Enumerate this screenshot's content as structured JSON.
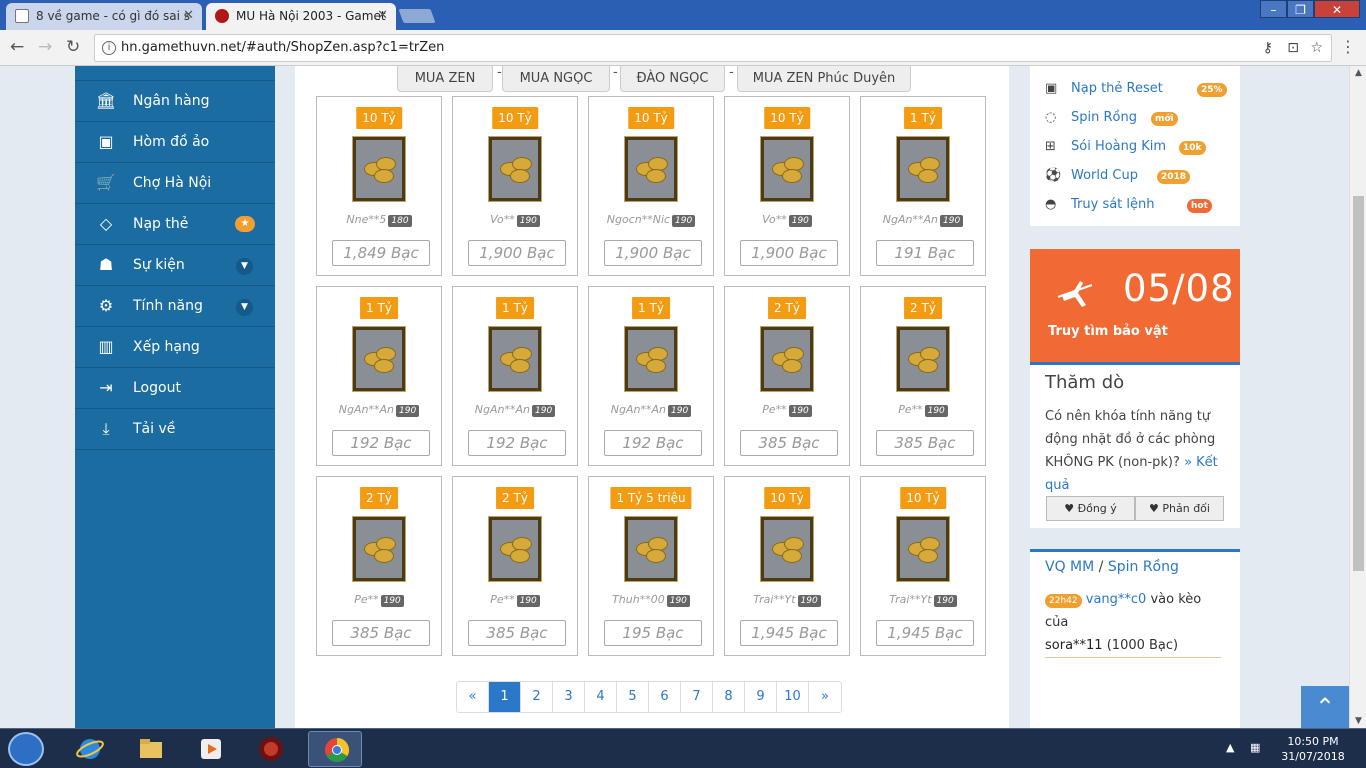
{
  "browser": {
    "tabs": [
      {
        "label": "8 về game - có gì đó sai s"
      },
      {
        "label": "MU Hà Nội 2003 - Gamet"
      }
    ],
    "url": "hn.gamethuvn.net/#auth/ShopZen.asp?c1=trZen"
  },
  "sidebar": {
    "items": [
      {
        "label": "Ngân hàng",
        "icon": "bank-icon"
      },
      {
        "label": "Hòm đồ ảo",
        "icon": "briefcase-icon"
      },
      {
        "label": "Chợ Hà Nội",
        "icon": "cart-icon"
      },
      {
        "label": "Nạp thẻ",
        "icon": "diamond-icon"
      },
      {
        "label": "Sự kiện",
        "icon": "android-icon"
      },
      {
        "label": "Tính năng",
        "icon": "cogs-icon"
      },
      {
        "label": "Xếp hạng",
        "icon": "bar-chart-icon"
      },
      {
        "label": "Logout",
        "icon": "sign-out-icon"
      },
      {
        "label": "Tải về",
        "icon": "download-icon"
      }
    ]
  },
  "shop": {
    "tabs": [
      "MUA ZEN",
      "MUA NGỌC",
      "ĐÀO NGỌC",
      "MUA ZEN Phúc Duyên"
    ],
    "separator": "-",
    "items": [
      {
        "amount": "10 Tỷ",
        "seller": "Nne**5",
        "level": "180",
        "price": "1,849 Bạc"
      },
      {
        "amount": "10 Tỷ",
        "seller": "Vo**",
        "level": "190",
        "price": "1,900 Bạc"
      },
      {
        "amount": "10 Tỷ",
        "seller": "Ngocn**Nic",
        "level": "190",
        "price": "1,900 Bạc"
      },
      {
        "amount": "10 Tỷ",
        "seller": "Vo**",
        "level": "190",
        "price": "1,900 Bạc"
      },
      {
        "amount": "1 Tỷ",
        "seller": "NgAn**An",
        "level": "190",
        "price": "191 Bạc"
      },
      {
        "amount": "1 Tỷ",
        "seller": "NgAn**An",
        "level": "190",
        "price": "192 Bạc"
      },
      {
        "amount": "1 Tỷ",
        "seller": "NgAn**An",
        "level": "190",
        "price": "192 Bạc"
      },
      {
        "amount": "1 Tỷ",
        "seller": "NgAn**An",
        "level": "190",
        "price": "192 Bạc"
      },
      {
        "amount": "2 Tỷ",
        "seller": "Pe**",
        "level": "190",
        "price": "385 Bạc"
      },
      {
        "amount": "2 Tỷ",
        "seller": "Pe**",
        "level": "190",
        "price": "385 Bạc"
      },
      {
        "amount": "2 Tỷ",
        "seller": "Pe**",
        "level": "190",
        "price": "385 Bạc"
      },
      {
        "amount": "2 Tỷ",
        "seller": "Pe**",
        "level": "190",
        "price": "385 Bạc"
      },
      {
        "amount": "1 Tỷ 5 triệu",
        "seller": "Thuh**00",
        "level": "190",
        "price": "195 Bạc"
      },
      {
        "amount": "10 Tỷ",
        "seller": "Trai**Yt",
        "level": "190",
        "price": "1,945 Bạc"
      },
      {
        "amount": "10 Tỷ",
        "seller": "Trai**Yt",
        "level": "190",
        "price": "1,945 Bạc"
      }
    ],
    "pagination": {
      "prev": "«",
      "pages": [
        "1",
        "2",
        "3",
        "4",
        "5",
        "6",
        "7",
        "8",
        "9",
        "10"
      ],
      "next": "»",
      "current": "1"
    }
  },
  "right": {
    "links": [
      {
        "label": "Nạp thẻ Reset",
        "badge": "25%",
        "icon": "card-reset-icon"
      },
      {
        "label": "Spin Rồng",
        "badge": "mới",
        "icon": "spinner-icon"
      },
      {
        "label": "Sói Hoàng Kim",
        "badge": "10k",
        "icon": "gift-icon"
      },
      {
        "label": "World Cup",
        "badge": "2018",
        "icon": "soccer-ball-icon"
      },
      {
        "label": "Truy sát lệnh",
        "badge": "hot",
        "icon": "cat-icon"
      }
    ],
    "treasure": {
      "date": "05/08",
      "label": "Truy tìm bảo vật"
    },
    "poll": {
      "title": "Thăm dò",
      "question": "Có nên khóa tính năng tự động nhặt đồ ở các phòng KHÔNG PK (non-pk)?",
      "result_link": "» Kết quả",
      "agree": "Đồng ý",
      "disagree": "Phản đối"
    },
    "vq": {
      "title_a": "VQ MM",
      "slash": " / ",
      "title_b": "Spin Rồng",
      "time": "22h42",
      "user1": "vang**c0",
      "text1": " vào kèo của",
      "user2": "sora**11",
      "text2": " (1000 Bạc)"
    }
  },
  "taskbar": {
    "time": "10:50 PM",
    "date": "31/07/2018"
  },
  "colors": {
    "sidebar": "#1b6ca0",
    "accent": "#f39c12",
    "link": "#2b78c8",
    "treasure": "#f26a33"
  }
}
